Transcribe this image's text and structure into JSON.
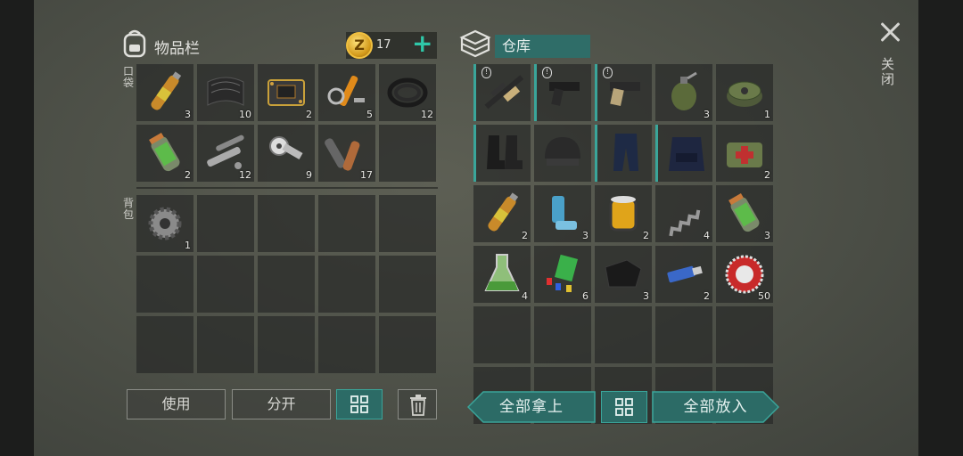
{
  "close": {
    "label": "关闭"
  },
  "inventory": {
    "title": "物品栏",
    "coins": {
      "icon": "z-coin-icon",
      "count": "17",
      "plus": "+"
    },
    "pocket_label": "口袋",
    "backpack_label": "背包",
    "pocket_slots": [
      {
        "icon": "ampoule-icon",
        "qty": "3"
      },
      {
        "icon": "carbon-sheet-icon",
        "qty": "10"
      },
      {
        "icon": "circuit-board-icon",
        "qty": "2"
      },
      {
        "icon": "hydraulic-parts-icon",
        "qty": "5"
      },
      {
        "icon": "rubber-hose-icon",
        "qty": "12"
      },
      {
        "icon": "medicine-vial-icon",
        "qty": "2"
      },
      {
        "icon": "pipes-bolts-icon",
        "qty": "12"
      },
      {
        "icon": "mechanical-parts-icon",
        "qty": "9"
      },
      {
        "icon": "pipe-fittings-icon",
        "qty": "17"
      },
      {
        "icon": "",
        "qty": ""
      }
    ],
    "backpack_slots": [
      {
        "icon": "gear-icon",
        "qty": "1"
      },
      {
        "icon": "",
        "qty": ""
      },
      {
        "icon": "",
        "qty": ""
      },
      {
        "icon": "",
        "qty": ""
      },
      {
        "icon": "",
        "qty": ""
      },
      {
        "icon": "",
        "qty": ""
      },
      {
        "icon": "",
        "qty": ""
      },
      {
        "icon": "",
        "qty": ""
      },
      {
        "icon": "",
        "qty": ""
      },
      {
        "icon": "",
        "qty": ""
      },
      {
        "icon": "",
        "qty": ""
      },
      {
        "icon": "",
        "qty": ""
      },
      {
        "icon": "",
        "qty": ""
      },
      {
        "icon": "",
        "qty": ""
      },
      {
        "icon": "",
        "qty": ""
      }
    ],
    "buttons": {
      "use": "使用",
      "split": "分开"
    }
  },
  "storage": {
    "title": "仓库",
    "slots": [
      {
        "icon": "sniper-rifle-icon",
        "qty": "",
        "badge": "!",
        "accent": true
      },
      {
        "icon": "pistol-icon",
        "qty": "",
        "badge": "!",
        "accent": true
      },
      {
        "icon": "pistol-tan-icon",
        "qty": "",
        "badge": "!",
        "accent": true
      },
      {
        "icon": "grenade-icon",
        "qty": "3",
        "badge": "",
        "accent": false
      },
      {
        "icon": "landmine-icon",
        "qty": "1",
        "badge": "",
        "accent": false
      },
      {
        "icon": "boots-icon",
        "qty": "",
        "badge": "",
        "accent": true
      },
      {
        "icon": "helmet-icon",
        "qty": "",
        "badge": "",
        "accent": false
      },
      {
        "icon": "pants-icon",
        "qty": "",
        "badge": "",
        "accent": true
      },
      {
        "icon": "tactical-vest-icon",
        "qty": "",
        "badge": "",
        "accent": true
      },
      {
        "icon": "first-aid-bag-icon",
        "qty": "2",
        "badge": "",
        "accent": false
      },
      {
        "icon": "ampoule-icon",
        "qty": "2",
        "badge": "",
        "accent": false
      },
      {
        "icon": "inhaler-icon",
        "qty": "3",
        "badge": "",
        "accent": false
      },
      {
        "icon": "oil-filter-icon",
        "qty": "2",
        "badge": "",
        "accent": false
      },
      {
        "icon": "spring-icon",
        "qty": "4",
        "badge": "",
        "accent": false
      },
      {
        "icon": "medicine-vial-icon",
        "qty": "3",
        "badge": "",
        "accent": false
      },
      {
        "icon": "chemical-flask-icon",
        "qty": "4",
        "badge": "",
        "accent": false
      },
      {
        "icon": "plastic-pieces-icon",
        "qty": "6",
        "badge": "",
        "accent": false
      },
      {
        "icon": "leather-icon",
        "qty": "3",
        "badge": "",
        "accent": false
      },
      {
        "icon": "usb-drive-icon",
        "qty": "2",
        "badge": "",
        "accent": false
      },
      {
        "icon": "bottle-cap-icon",
        "qty": "50",
        "badge": "",
        "accent": false
      },
      {
        "icon": "",
        "qty": "",
        "badge": "",
        "accent": false
      },
      {
        "icon": "",
        "qty": "",
        "badge": "",
        "accent": false
      },
      {
        "icon": "",
        "qty": "",
        "badge": "",
        "accent": false
      },
      {
        "icon": "",
        "qty": "",
        "badge": "",
        "accent": false
      },
      {
        "icon": "",
        "qty": "",
        "badge": "",
        "accent": false
      },
      {
        "icon": "",
        "qty": "",
        "badge": "",
        "accent": false
      },
      {
        "icon": "",
        "qty": "",
        "badge": "",
        "accent": false
      },
      {
        "icon": "",
        "qty": "",
        "badge": "",
        "accent": false
      },
      {
        "icon": "",
        "qty": "",
        "badge": "",
        "accent": false
      },
      {
        "icon": "",
        "qty": "",
        "badge": "",
        "accent": false
      }
    ],
    "buttons": {
      "take_all": "全部拿上",
      "put_all": "全部放入"
    }
  },
  "colors": {
    "accent": "#3aa59a",
    "teal_fill": "#2c6b66",
    "coin_gold": "#f0c040"
  }
}
